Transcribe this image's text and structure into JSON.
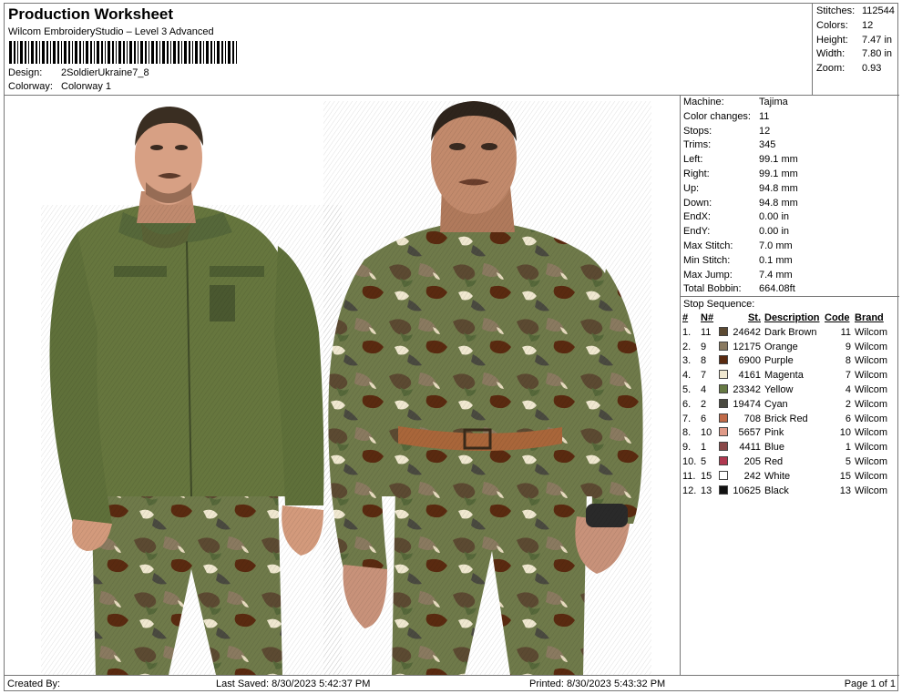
{
  "header": {
    "title": "Production Worksheet",
    "software": "Wilcom EmbroideryStudio – Level 3 Advanced",
    "design_label": "Design:",
    "design_value": "2SoldierUkraine7_8",
    "colorway_label": "Colorway:",
    "colorway_value": "Colorway 1"
  },
  "summary": [
    {
      "label": "Stitches:",
      "value": "112544"
    },
    {
      "label": "Colors:",
      "value": "12"
    },
    {
      "label": "Height:",
      "value": "7.47 in"
    },
    {
      "label": "Width:",
      "value": "7.80 in"
    },
    {
      "label": "Zoom:",
      "value": "0.93"
    }
  ],
  "machine_info": [
    {
      "label": "Machine:",
      "value": "Tajima"
    },
    {
      "label": "Color changes:",
      "value": "11"
    },
    {
      "label": "Stops:",
      "value": "12"
    },
    {
      "label": "Trims:",
      "value": "345"
    },
    {
      "label": "Left:",
      "value": "99.1 mm"
    },
    {
      "label": "Right:",
      "value": "99.1 mm"
    },
    {
      "label": "Up:",
      "value": "94.8 mm"
    },
    {
      "label": "Down:",
      "value": "94.8 mm"
    },
    {
      "label": "EndX:",
      "value": "0.00 in"
    },
    {
      "label": "EndY:",
      "value": "0.00 in"
    },
    {
      "label": "Max Stitch:",
      "value": "7.0 mm"
    },
    {
      "label": "Min Stitch:",
      "value": "0.1 mm"
    },
    {
      "label": "Max Jump:",
      "value": "7.4 mm"
    },
    {
      "label": "Total Bobbin:",
      "value": "664.08ft"
    }
  ],
  "stop_sequence": {
    "label": "Stop Sequence:",
    "headers": {
      "num": "#",
      "needle": "N#",
      "stitches": "St.",
      "description": "Description",
      "code": "Code",
      "brand": "Brand"
    },
    "rows": [
      {
        "num": "1.",
        "needle": "11",
        "color": "#5c4a32",
        "stitches": "24642",
        "description": "Dark Brown",
        "code": "11",
        "brand": "Wilcom"
      },
      {
        "num": "2.",
        "needle": "9",
        "color": "#8a7a60",
        "stitches": "12175",
        "description": "Orange",
        "code": "9",
        "brand": "Wilcom"
      },
      {
        "num": "3.",
        "needle": "8",
        "color": "#5a2a10",
        "stitches": "6900",
        "description": "Purple",
        "code": "8",
        "brand": "Wilcom"
      },
      {
        "num": "4.",
        "needle": "7",
        "color": "#f0e8d0",
        "stitches": "4161",
        "description": "Magenta",
        "code": "7",
        "brand": "Wilcom"
      },
      {
        "num": "5.",
        "needle": "4",
        "color": "#667a44",
        "stitches": "23342",
        "description": "Yellow",
        "code": "4",
        "brand": "Wilcom"
      },
      {
        "num": "6.",
        "needle": "2",
        "color": "#4a4a40",
        "stitches": "19474",
        "description": "Cyan",
        "code": "2",
        "brand": "Wilcom"
      },
      {
        "num": "7.",
        "needle": "6",
        "color": "#c06a48",
        "stitches": "708",
        "description": "Brick Red",
        "code": "6",
        "brand": "Wilcom"
      },
      {
        "num": "8.",
        "needle": "10",
        "color": "#e09a88",
        "stitches": "5657",
        "description": "Pink",
        "code": "10",
        "brand": "Wilcom"
      },
      {
        "num": "9.",
        "needle": "1",
        "color": "#8a4848",
        "stitches": "4411",
        "description": "Blue",
        "code": "1",
        "brand": "Wilcom"
      },
      {
        "num": "10.",
        "needle": "5",
        "color": "#b03850",
        "stitches": "205",
        "description": "Red",
        "code": "5",
        "brand": "Wilcom"
      },
      {
        "num": "11.",
        "needle": "15",
        "color": "#ffffff",
        "stitches": "242",
        "description": "White",
        "code": "15",
        "brand": "Wilcom"
      },
      {
        "num": "12.",
        "needle": "13",
        "color": "#111111",
        "stitches": "10625",
        "description": "Black",
        "code": "13",
        "brand": "Wilcom"
      }
    ]
  },
  "footer": {
    "created_by": "Created By:",
    "last_saved": "Last Saved: 8/30/2023 5:42:37 PM",
    "printed": "Printed: 8/30/2023 5:43:32 PM",
    "page": "Page 1 of 1"
  }
}
